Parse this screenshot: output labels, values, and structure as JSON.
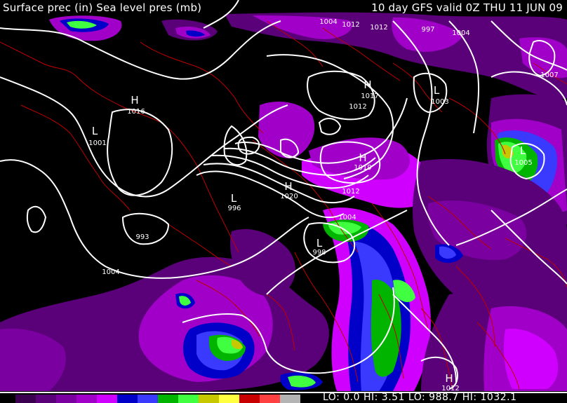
{
  "header": {
    "left_title": "Surface prec (in) Sea level pres (mb)",
    "right_title": "10 day GFS valid 0Z THU 11 JUN 09"
  },
  "legend": {
    "colors": [
      "#3c0050",
      "#5a0078",
      "#7a00a0",
      "#a000c8",
      "#d000ff",
      "#0000c8",
      "#3a3aff",
      "#00b400",
      "#40ff40",
      "#c8c800",
      "#ffff40",
      "#c80000",
      "#ff4040",
      "#b4b4b4"
    ]
  },
  "stats": {
    "lo_precip": "LO:  0.0",
    "hi_precip": "HI: 3.51",
    "lo_pres": "LO: 988.7",
    "hi_pres": "HI: 1032.1"
  },
  "pressure_labels": [
    {
      "text": "1004",
      "kind": "value"
    },
    {
      "text": "1012",
      "kind": "value"
    },
    {
      "text": "1012",
      "kind": "value"
    },
    {
      "text": "997",
      "kind": "value"
    },
    {
      "text": "1004",
      "kind": "value"
    },
    {
      "text": "1007",
      "kind": "value"
    },
    {
      "text": "H",
      "kind": "center"
    },
    {
      "text": "1016",
      "kind": "value"
    },
    {
      "text": "L",
      "kind": "center"
    },
    {
      "text": "1001",
      "kind": "value"
    },
    {
      "text": "H",
      "kind": "center"
    },
    {
      "text": "1017",
      "kind": "value"
    },
    {
      "text": "1012",
      "kind": "value"
    },
    {
      "text": "L",
      "kind": "center"
    },
    {
      "text": "1003",
      "kind": "value"
    },
    {
      "text": "H",
      "kind": "center"
    },
    {
      "text": "1019",
      "kind": "value"
    },
    {
      "text": "L",
      "kind": "center"
    },
    {
      "text": "1005",
      "kind": "value"
    },
    {
      "text": "H",
      "kind": "center"
    },
    {
      "text": "1020",
      "kind": "value"
    },
    {
      "text": "1012",
      "kind": "value"
    },
    {
      "text": "L",
      "kind": "center"
    },
    {
      "text": "996",
      "kind": "value"
    },
    {
      "text": "1004",
      "kind": "value"
    },
    {
      "text": "993",
      "kind": "value"
    },
    {
      "text": "L",
      "kind": "center"
    },
    {
      "text": "998",
      "kind": "value"
    },
    {
      "text": "1004",
      "kind": "value"
    },
    {
      "text": "H",
      "kind": "center"
    },
    {
      "text": "1012",
      "kind": "value"
    }
  ]
}
